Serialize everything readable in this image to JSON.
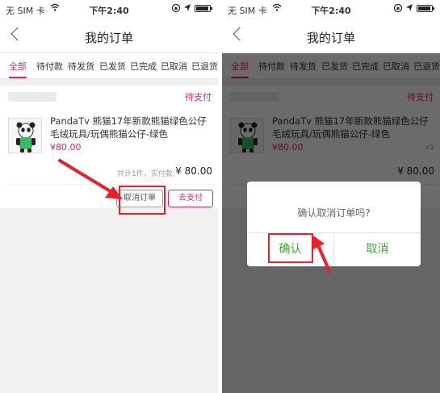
{
  "status_bar": {
    "carrier": "无 SIM 卡",
    "time": "下午2:40"
  },
  "header": {
    "title": "我的订单"
  },
  "tabs": [
    {
      "label": "全部",
      "active": true
    },
    {
      "label": "待付款",
      "active": false
    },
    {
      "label": "待发货",
      "active": false
    },
    {
      "label": "已发货",
      "active": false
    },
    {
      "label": "已完成",
      "active": false
    },
    {
      "label": "已取消",
      "active": false
    },
    {
      "label": "已退货",
      "active": false
    }
  ],
  "order": {
    "status": "待支付",
    "product_name": "PandaTv 熊猫17年新款熊猫绿色公仔毛绒玩具/玩偶熊猫公仔-绿色",
    "price": "¥80.00",
    "quantity": "x1",
    "summary": "共计1件，实付款:",
    "total": "¥ 80.00",
    "cancel_label": "取消订单",
    "pay_label": "去支付"
  },
  "dialog": {
    "message": "确认取消订单吗?",
    "confirm_label": "确认",
    "cancel_label": "取消"
  },
  "colors": {
    "accent": "#e6245f",
    "annotation_red": "#e8202a",
    "dialog_green": "#3aab3a"
  }
}
